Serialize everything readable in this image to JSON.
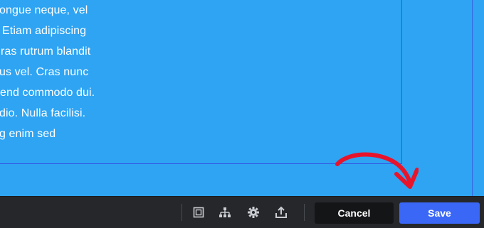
{
  "content": {
    "lines": [
      "ongue neque, vel",
      "Etiam adipiscing",
      "ras rutrum blandit",
      "us vel. Cras nunc",
      "end commodo dui.",
      "dio. Nulla facilisi.",
      "g enim sed"
    ]
  },
  "toolbar": {
    "icons": [
      "frame-icon",
      "sitemap-icon",
      "gear-icon",
      "share-icon"
    ],
    "cancel_label": "Cancel",
    "save_label": "Save"
  },
  "colors": {
    "canvas_background": "#2ea4f3",
    "toolbar_background": "#25272b",
    "cancel_button": "#141517",
    "save_button": "#3a67f6",
    "annotation_arrow": "#e8142b"
  }
}
